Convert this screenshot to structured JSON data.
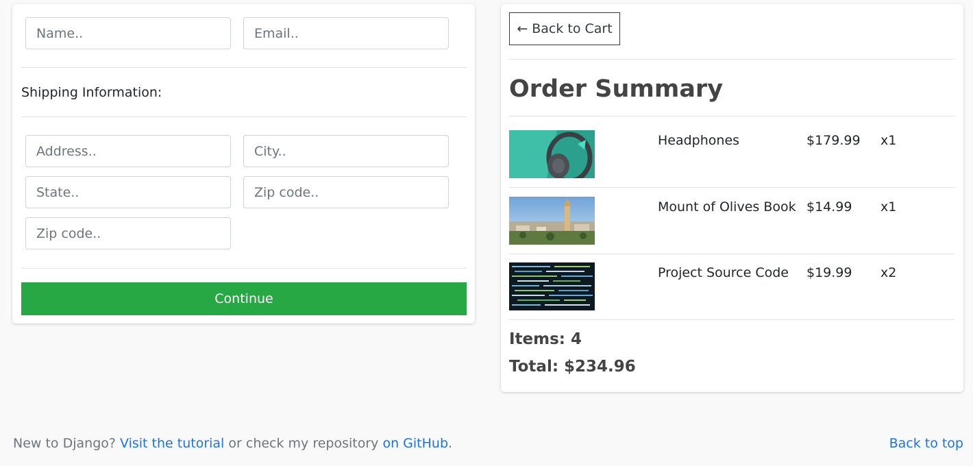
{
  "checkout_form": {
    "user_fields": {
      "name_placeholder": "Name..",
      "email_placeholder": "Email.."
    },
    "shipping_label": "Shipping Information:",
    "shipping_fields": {
      "address_placeholder": "Address..",
      "city_placeholder": "City..",
      "state_placeholder": "State..",
      "zip_placeholder": "Zip code..",
      "zip2_placeholder": "Zip code.."
    },
    "continue_label": "Continue"
  },
  "summary": {
    "back_label": "Back to Cart",
    "back_arrow": "←",
    "title": "Order Summary",
    "items": [
      {
        "name": "Headphones",
        "price": "$179.99",
        "qty": "x1",
        "thumb": "headphones-image"
      },
      {
        "name": "Mount of Olives Book",
        "price": "$14.99",
        "qty": "x1",
        "thumb": "mount-of-olives-image"
      },
      {
        "name": "Project Source Code",
        "price": "$19.99",
        "qty": "x2",
        "thumb": "source-code-image"
      }
    ],
    "items_total": "Items: 4",
    "total": "Total: $234.96"
  },
  "footer": {
    "text_prefix": "New to Django?",
    "tutorial_link": "Visit the tutorial",
    "text_middle": "or check my repository",
    "github_link": "on GitHub",
    "text_suffix": ".",
    "back_to_top": "Back to top"
  },
  "colors": {
    "accent_green": "#28a745",
    "link_blue": "#1a73e8",
    "background": "#f9f9f9"
  }
}
